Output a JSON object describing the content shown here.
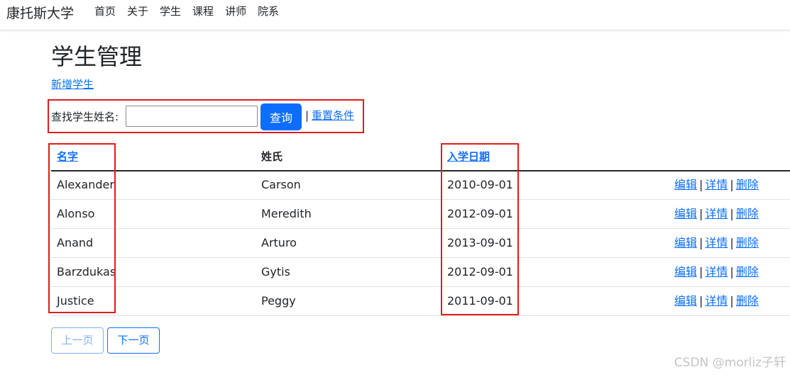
{
  "navbar": {
    "brand": "康托斯大学",
    "links": [
      "首页",
      "关于",
      "学生",
      "课程",
      "讲师",
      "院系"
    ]
  },
  "page": {
    "title": "学生管理",
    "create_link": "新增学生"
  },
  "search": {
    "label": "查找学生姓名:",
    "value": "",
    "placeholder": "",
    "button": "查询",
    "separator": "|",
    "reset_link": "重置条件"
  },
  "table": {
    "headers": {
      "first_name": "名字",
      "last_name": "姓氏",
      "enrollment_date": "入学日期"
    },
    "rows": [
      {
        "first_name": "Alexander",
        "last_name": "Carson",
        "enrollment_date": "2010-09-01"
      },
      {
        "first_name": "Alonso",
        "last_name": "Meredith",
        "enrollment_date": "2012-09-01"
      },
      {
        "first_name": "Anand",
        "last_name": "Arturo",
        "enrollment_date": "2013-09-01"
      },
      {
        "first_name": "Barzdukas",
        "last_name": "Gytis",
        "enrollment_date": "2012-09-01"
      },
      {
        "first_name": "Justice",
        "last_name": "Peggy",
        "enrollment_date": "2011-09-01"
      }
    ],
    "actions": {
      "edit": "编辑",
      "details": "详情",
      "delete": "删除",
      "separator": "|"
    }
  },
  "pagination": {
    "prev": "上一页",
    "next": "下一页"
  },
  "watermark": "CSDN @morliz子轩",
  "colors": {
    "accent": "#0d6efd",
    "highlight": "#e11b1b"
  }
}
